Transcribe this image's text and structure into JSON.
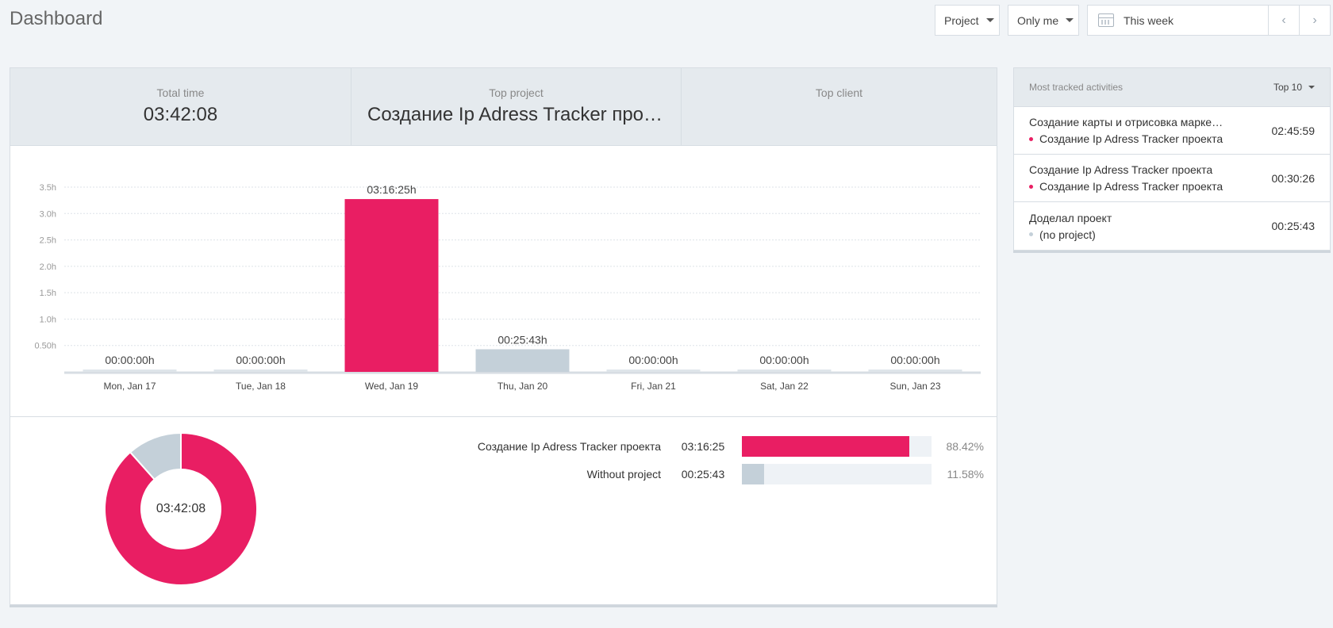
{
  "header": {
    "title": "Dashboard"
  },
  "filters": {
    "project_label": "Project",
    "user_label": "Only me",
    "date_label": "This week",
    "prev_glyph": "‹",
    "next_glyph": "›"
  },
  "stats": {
    "total_label": "Total time",
    "total_value": "03:42:08",
    "top_project_label": "Top project",
    "top_project_value": "Создание Ip Adress Tracker проекта",
    "top_client_label": "Top client",
    "top_client_value": ""
  },
  "colors": {
    "accent": "#e91e63",
    "neutral": "#c4d0d9",
    "track": "#eef2f6"
  },
  "chart_data": {
    "type": "bar",
    "categories": [
      "Mon, Jan 17",
      "Tue, Jan 18",
      "Wed, Jan 19",
      "Thu, Jan 20",
      "Fri, Jan 21",
      "Sat, Jan 22",
      "Sun, Jan 23"
    ],
    "series": [
      {
        "values": [
          0,
          0,
          3.2736,
          0,
          0,
          0,
          0
        ],
        "color": "#e91e63"
      },
      {
        "values": [
          0,
          0,
          0,
          0.4286,
          0,
          0,
          0
        ],
        "color": "#c4d0d9"
      }
    ],
    "bar_labels": [
      "00:00:00h",
      "00:00:00h",
      "03:16:25h",
      "00:25:43h",
      "00:00:00h",
      "00:00:00h",
      "00:00:00h"
    ],
    "yticks": [
      0.5,
      1.0,
      1.5,
      2.0,
      2.5,
      3.0,
      3.5
    ],
    "ytick_labels": [
      "0.50h",
      "1.0h",
      "1.5h",
      "2.0h",
      "2.5h",
      "3.0h",
      "3.5h"
    ],
    "ylim": [
      0,
      3.5
    ],
    "grid": true
  },
  "breakdown": {
    "total": "03:42:08",
    "items": [
      {
        "name": "Создание Ip Adress Tracker проекта",
        "time": "03:16:25",
        "percent": "88.42%",
        "fraction": 0.8842,
        "color": "#e91e63"
      },
      {
        "name": "Without project",
        "time": "00:25:43",
        "percent": "11.58%",
        "fraction": 0.1158,
        "color": "#c4d0d9"
      }
    ]
  },
  "activities": {
    "title": "Most tracked activities",
    "top_label": "Top 10",
    "items": [
      {
        "description": "Создание карты и отрисовка маркеров",
        "project": "Создание Ip Adress Tracker проекта",
        "project_color": "#e91e63",
        "duration": "02:45:59"
      },
      {
        "description": "Создание Ip Adress Tracker проекта",
        "project": "Создание Ip Adress Tracker проекта",
        "project_color": "#e91e63",
        "duration": "00:30:26"
      },
      {
        "description": "Доделал проект",
        "project": "(no project)",
        "project_color": "#c4d0d9",
        "duration": "00:25:43"
      }
    ]
  }
}
